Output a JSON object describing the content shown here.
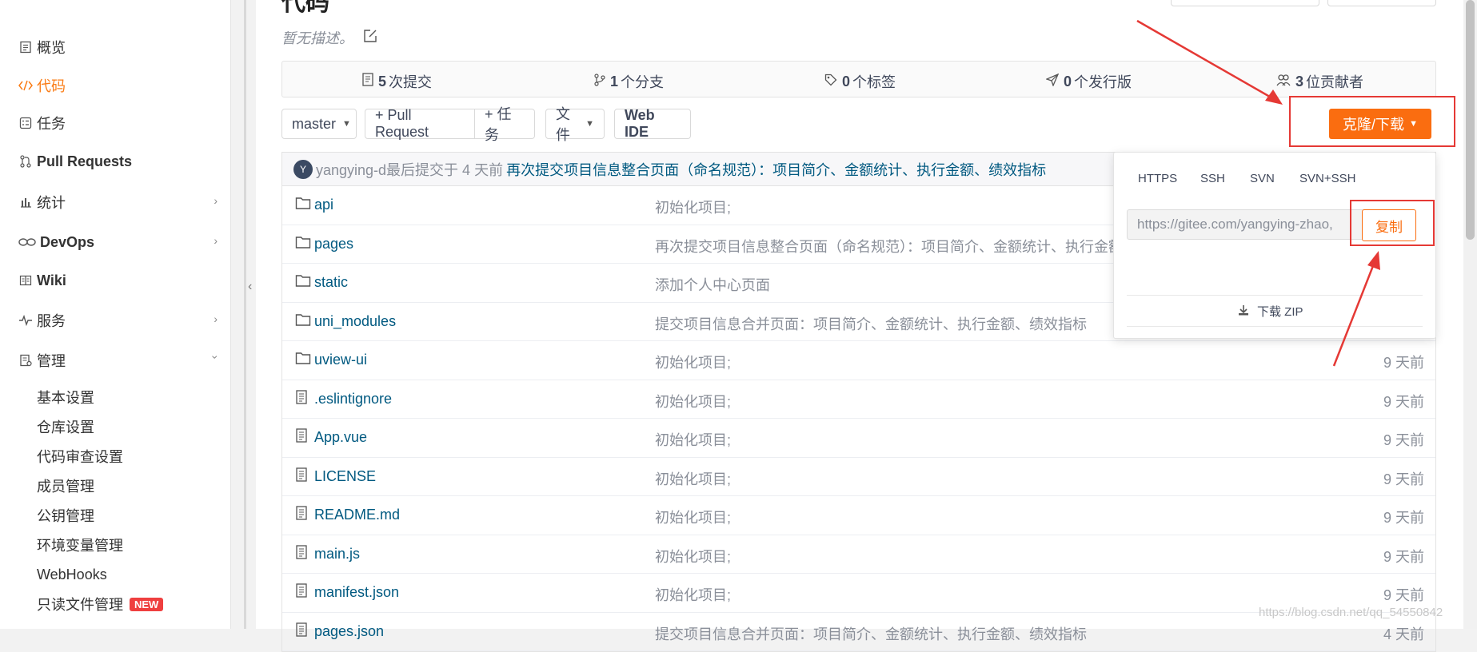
{
  "sidebar": {
    "items": [
      {
        "label": "概览",
        "icon": "overview-icon"
      },
      {
        "label": "代码",
        "icon": "code-icon",
        "active": true
      },
      {
        "label": "任务",
        "icon": "task-icon"
      },
      {
        "label": "Pull Requests",
        "icon": "pull-request-icon"
      },
      {
        "label": "统计",
        "icon": "stats-icon"
      },
      {
        "label": "DevOps",
        "icon": "devops-icon"
      },
      {
        "label": "Wiki",
        "icon": "wiki-icon"
      },
      {
        "label": "服务",
        "icon": "service-icon"
      },
      {
        "label": "管理",
        "icon": "manage-icon",
        "expanded": true
      }
    ],
    "sub_items": [
      "基本设置",
      "仓库设置",
      "代码审查设置",
      "成员管理",
      "公钥管理",
      "环境变量管理",
      "WebHooks",
      "只读文件管理"
    ],
    "new_badge": "NEW"
  },
  "repo": {
    "title": "代码",
    "description": "暂无描述。"
  },
  "stats": {
    "commits_num": "5",
    "commits_label": "次提交",
    "branches_num": "1",
    "branches_label": "个分支",
    "tags_num": "0",
    "tags_label": "个标签",
    "releases_num": "0",
    "releases_label": "个发行版",
    "contributors_num": "3",
    "contributors_label": "位贡献者"
  },
  "toolbar": {
    "branch": "master",
    "pull_request": "+ Pull Request",
    "task": "+ 任务",
    "file": "文件",
    "web_ide": "Web IDE",
    "clone": "克隆/下载"
  },
  "last_commit": {
    "avatar_letter": "Y",
    "author_line": "yangying-d最后提交于 4 天前",
    "message": "再次提交项目信息整合页面（命名规范）：项目简介、金额统计、执行金额、绩效指标"
  },
  "files": [
    {
      "name": "api",
      "type": "folder",
      "message": "初始化项目;",
      "time": ""
    },
    {
      "name": "pages",
      "type": "folder",
      "message": "再次提交项目信息整合页面（命名规范）：项目简介、金额统计、执行金额",
      "time": ""
    },
    {
      "name": "static",
      "type": "folder",
      "message": "添加个人中心页面",
      "time": ""
    },
    {
      "name": "uni_modules",
      "type": "folder",
      "message": "提交项目信息合并页面：项目简介、金额统计、执行金额、绩效指标",
      "time": ""
    },
    {
      "name": "uview-ui",
      "type": "folder",
      "message": "初始化项目;",
      "time": "9 天前"
    },
    {
      "name": ".eslintignore",
      "type": "file",
      "message": "初始化项目;",
      "time": "9 天前"
    },
    {
      "name": "App.vue",
      "type": "file",
      "message": "初始化项目;",
      "time": "9 天前"
    },
    {
      "name": "LICENSE",
      "type": "file",
      "message": "初始化项目;",
      "time": "9 天前"
    },
    {
      "name": "README.md",
      "type": "file",
      "message": "初始化项目;",
      "time": "9 天前"
    },
    {
      "name": "main.js",
      "type": "file",
      "message": "初始化项目;",
      "time": "9 天前"
    },
    {
      "name": "manifest.json",
      "type": "file",
      "message": "初始化项目;",
      "time": "9 天前"
    },
    {
      "name": "pages.json",
      "type": "file",
      "message": "提交项目信息合并页面：项目简介、金额统计、执行金额、绩效指标",
      "time": "4 天前"
    }
  ],
  "clone_dropdown": {
    "tabs": [
      "HTTPS",
      "SSH",
      "SVN",
      "SVN+SSH"
    ],
    "url": "https://gitee.com/yangying-zhao,",
    "copy": "复制",
    "download_zip": "下载 ZIP"
  },
  "watermark": "https://blog.csdn.net/qq_54550842",
  "colors": {
    "accent": "#fa6d10",
    "link": "#005980",
    "annotation_red": "#e53935"
  }
}
